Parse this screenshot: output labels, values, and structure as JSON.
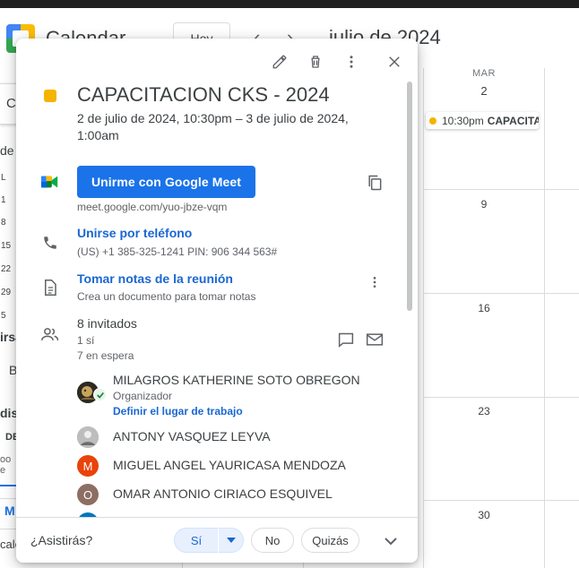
{
  "app": {
    "name": "Calendar",
    "today_label": "Hoy",
    "prev_glyph": "‹",
    "next_glyph": "›",
    "month_title": "julio de 2024"
  },
  "background": {
    "sidebar_frags": [
      "C",
      "de",
      "L",
      "1",
      "8",
      "15",
      "22",
      "29",
      "5",
      "irsa",
      "B",
      "dist",
      "DE",
      "oo e",
      "M",
      "cale"
    ],
    "columns": {
      "day_of_week": "MAR",
      "day_number": "2"
    },
    "week_days": [
      "9",
      "16",
      "23",
      "30"
    ],
    "calendar_event": {
      "time": "10:30pm",
      "title": "CAPACITA"
    }
  },
  "popup": {
    "toolbar": {
      "edit_icon": "pencil-icon",
      "delete_icon": "trash-icon",
      "more_icon": "more-vert-icon",
      "close_icon": "close-icon"
    },
    "event": {
      "title": "CAPACITACION CKS - 2024",
      "date_text": "2 de julio de 2024, 10:30pm – 3 de julio de 2024, 1:00am",
      "color": "#f4b400"
    },
    "meet": {
      "button_label": "Unirme con Google Meet",
      "url": "meet.google.com/yuo-jbze-vqm"
    },
    "phone": {
      "label": "Unirse por teléfono",
      "details": "(US) +1 385-325-1241 PIN: 906 344 563#"
    },
    "notes": {
      "label": "Tomar notas de la reunión",
      "details": "Crea un documento para tomar notas"
    },
    "guests": {
      "summary": "8 invitados",
      "yes_count": "1 sí",
      "waiting_count": "7 en espera",
      "list": [
        {
          "name": "MILAGROS KATHERINE SOTO OBREGON",
          "role": "Organizador",
          "link": "Definir el lugar de trabajo"
        },
        {
          "name": "ANTONY VASQUEZ LEYVA"
        },
        {
          "name": "MIGUEL ANGEL YAURICASA MENDOZA",
          "initial": "M",
          "avatar_color": "#e8430a"
        },
        {
          "name": "OMAR ANTONIO CIRIACO ESQUIVEL",
          "initial": "O",
          "avatar_color": "#8d6e63"
        }
      ]
    },
    "rsvp": {
      "question": "¿Asistirás?",
      "yes": "Sí",
      "no": "No",
      "maybe": "Quizás"
    }
  }
}
